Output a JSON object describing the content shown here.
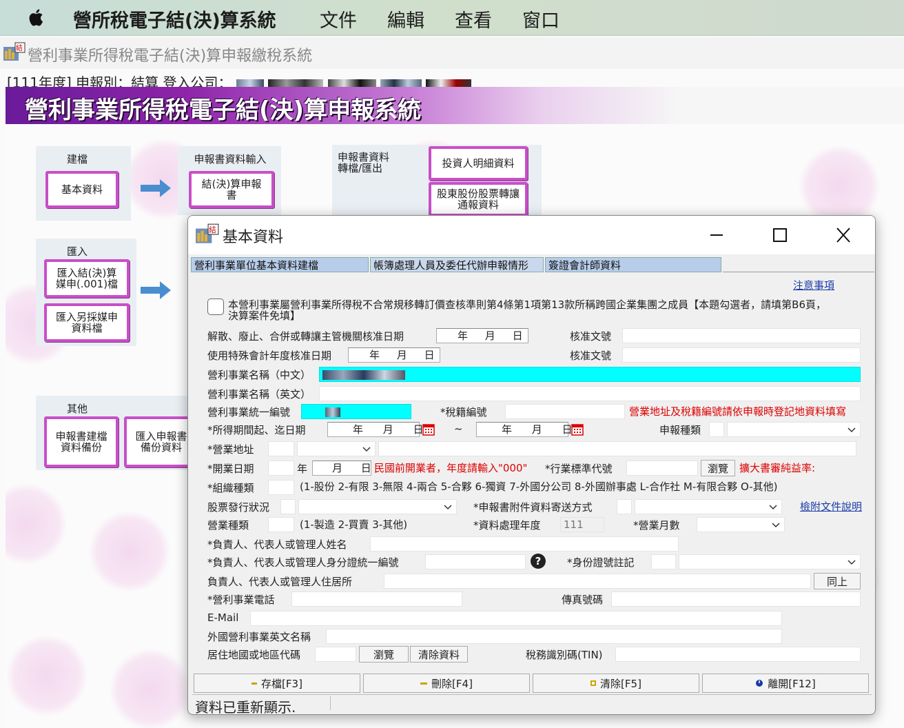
{
  "menubar": {
    "app_name": "營所稅電子結(決)算系統",
    "menus": [
      "文件",
      "編輯",
      "查看",
      "窗口"
    ]
  },
  "app": {
    "window_title": "營利事業所得稅電子結(決)算申報繳稅系統",
    "status_line": "[111年度] 申報別：結算    登入公司：",
    "banner": "營利事業所得稅電子結(決)算申報系統"
  },
  "launcher": {
    "group_build": {
      "label": "建檔",
      "button": "基本資料"
    },
    "group_input": {
      "label": "申報書資料輸入",
      "button": "結(決)算申報書"
    },
    "group_export": {
      "label": "申報書資料轉檔/匯出",
      "buttons": [
        "投資人明細資料",
        "股東股份股票轉讓通報資料"
      ]
    },
    "group_import": {
      "label": "匯入",
      "buttons": [
        "匯入結(決)算媒申(.001)檔",
        "匯入另採媒申資料檔"
      ]
    },
    "group_other": {
      "label": "其他",
      "buttons": [
        "申報書建檔資料備份",
        "匯入申報書備份資料"
      ]
    }
  },
  "dialog": {
    "title": "基本資料",
    "tabs": [
      "營利事業單位基本資料建檔",
      "帳簿處理人員及委任代辦申報情形",
      "簽證會計師資料"
    ],
    "notice_link": "注意事項",
    "checkbox_text_1": "本營利事業屬營利事業所得稅不合常規移轉訂價查核準則第4條第1項第13款所稱跨國企業集團之成員【本題勾選者，請填第B6頁，",
    "checkbox_text_2": "決算案件免填】",
    "fields": {
      "dissolve_date": "解散、廢止、合併或轉讓主管機關核准日期",
      "approval_no_1": "核准文號",
      "special_year_date": "使用特殊會計年度核准日期",
      "approval_no_2": "核准文號",
      "name_cn": "營利事業名稱（中文）",
      "name_en": "營利事業名稱（英文）",
      "unified_no": "營利事業統一編號",
      "tax_reg_no": "*稅籍編號",
      "address_notice": "營業地址及稅籍編號請依申報時登記地資料填寫",
      "period": "*所得期間起、迄日期",
      "period_sep": "~",
      "filing_type": "申報種類",
      "business_address": "*營業地址",
      "opening_date": "*開業日期",
      "opening_note": "民國前開業者，年度請輸入\"000\"",
      "industry_code": "*行業標準代號",
      "browse_btn": "瀏覽",
      "expand_rate": "擴大書審純益率:",
      "org_type": "*組織種類",
      "org_type_note": "(1-股份 2-有限 3-無限 4-兩合 5-合夥 6-獨資 7-外國分公司 8-外國辦事處 L-合作社 M-有限合夥 O-其他)",
      "stock_issue": "股票發行狀況",
      "attach_method": "*申報書附件資料寄送方式",
      "attach_link": "檢附文件說明",
      "business_type": "營業種類",
      "business_type_note": "(1-製造 2-買賣 3-其他)",
      "process_year": "*資料處理年度",
      "process_year_value": "111",
      "business_months": "*營業月數",
      "owner_name": "*負責人、代表人或管理人姓名",
      "owner_id": "*負責人、代表人或管理人身分證統一編號",
      "id_mark": "*身份證號註記",
      "owner_address": "負責人、代表人或管理人住居所",
      "same_btn": "同上",
      "phone": "*營利事業電話",
      "fax": "傳真號碼",
      "email": "E-Mail",
      "foreign_name": "外國營利事業英文名稱",
      "residence_code": "居住地國或地區代碼",
      "browse_btn_2": "瀏覽",
      "clear_btn": "清除資料",
      "tin": "稅務識別碼(TIN)"
    },
    "date_parts": {
      "y": "年",
      "m": "月",
      "d": "日"
    },
    "bottom_buttons": [
      "存檔[F3]",
      "刪除[F4]",
      "清除[F5]",
      "離開[F12]"
    ],
    "status": "資料已重新顯示."
  },
  "colors": {
    "accent": "#c84fc8",
    "highlight": "#00ffff",
    "tab": "#b7cdea",
    "warning": "#dd0000",
    "link": "#1a3aa8"
  }
}
